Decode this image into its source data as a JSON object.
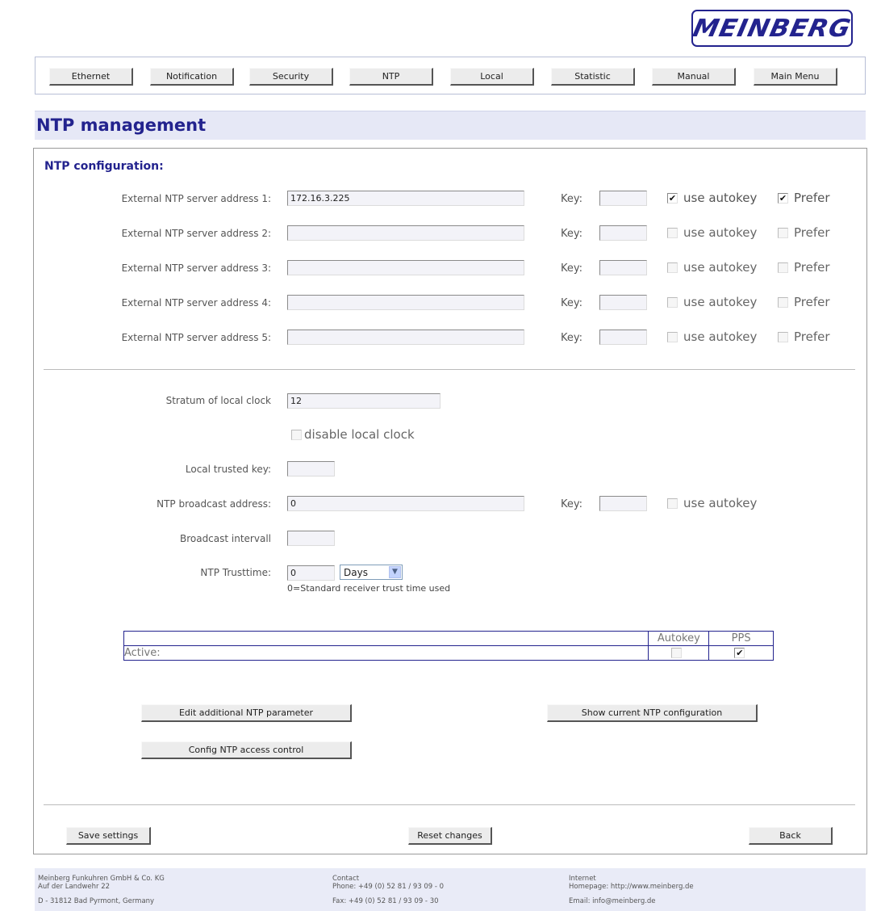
{
  "logo": {
    "text": "MEINBERG"
  },
  "nav": [
    "Ethernet",
    "Notification",
    "Security",
    "NTP",
    "Local",
    "Statistic",
    "Manual",
    "Main Menu"
  ],
  "page_title": "NTP management",
  "section_title": "NTP configuration:",
  "servers": [
    {
      "label": "External NTP server address 1:",
      "value": "172.16.3.225",
      "key_label": "Key:",
      "autokey_label": "use autokey",
      "autokey_checked": true,
      "prefer_label": "Prefer",
      "prefer_checked": true
    },
    {
      "label": "External NTP server address 2:",
      "value": "",
      "key_label": "Key:",
      "autokey_label": "use autokey",
      "autokey_checked": false,
      "prefer_label": "Prefer",
      "prefer_checked": false
    },
    {
      "label": "External NTP server address 3:",
      "value": "",
      "key_label": "Key:",
      "autokey_label": "use autokey",
      "autokey_checked": false,
      "prefer_label": "Prefer",
      "prefer_checked": false
    },
    {
      "label": "External NTP server address 4:",
      "value": "",
      "key_label": "Key:",
      "autokey_label": "use autokey",
      "autokey_checked": false,
      "prefer_label": "Prefer",
      "prefer_checked": false
    },
    {
      "label": "External NTP server address 5:",
      "value": "",
      "key_label": "Key:",
      "autokey_label": "use autokey",
      "autokey_checked": false,
      "prefer_label": "Prefer",
      "prefer_checked": false
    }
  ],
  "local": {
    "stratum_label": "Stratum of local clock",
    "stratum_value": "12",
    "disable_label": "disable local clock",
    "trusted_key_label": "Local trusted key:",
    "trusted_key_value": "",
    "broadcast_label": "NTP broadcast address:",
    "broadcast_value": "0",
    "broadcast_key_label": "Key:",
    "broadcast_autokey_label": "use autokey",
    "interval_label": "Broadcast intervall",
    "interval_value": "",
    "trusttime_label": "NTP Trusttime:",
    "trusttime_value": "0",
    "trusttime_unit": "Days",
    "trusttime_note": "0=Standard receiver trust time used"
  },
  "active_table": {
    "col_autokey": "Autokey",
    "col_pps": "PPS",
    "row_label": "Active:",
    "autokey_checked": false,
    "pps_checked": true
  },
  "buttons": {
    "edit_additional": "Edit additional NTP parameter",
    "show_config": "Show current NTP configuration",
    "access_control": "Config NTP access control",
    "save": "Save settings",
    "reset": "Reset changes",
    "back": "Back"
  },
  "footer": {
    "company": "Meinberg Funkuhren GmbH & Co. KG",
    "street": "Auf der Landwehr 22",
    "city": "D - 31812 Bad Pyrmont, Germany",
    "contact_title": "Contact",
    "phone": "Phone: +49 (0) 52 81 / 93 09 - 0",
    "fax": "Fax: +49 (0) 52 81 / 93 09 - 30",
    "internet_title": "Internet",
    "homepage": "Homepage: http://www.meinberg.de",
    "email": "Email: info@meinberg.de"
  }
}
